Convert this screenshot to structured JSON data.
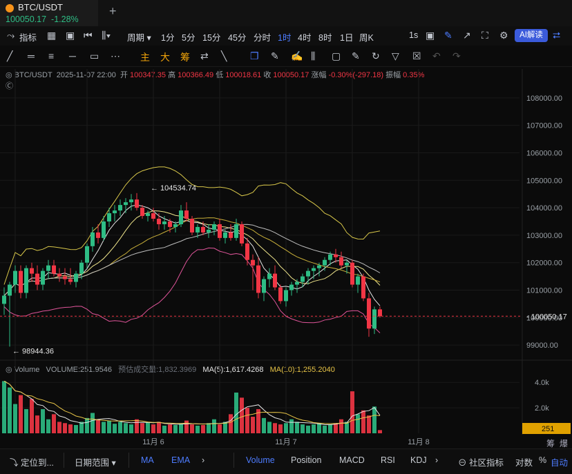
{
  "tab": {
    "symbol": "BTC/USDT",
    "price": "100050.17",
    "change": "-1.28%"
  },
  "toolbar1": {
    "indicators": "指标",
    "period": "周期",
    "intervals": [
      "1分",
      "5分",
      "15分",
      "45分",
      "分时",
      "1时",
      "4时",
      "8时",
      "1日",
      "周K"
    ],
    "active_interval": "1时",
    "seconds": "1s",
    "ai": "AI解读"
  },
  "toolbar2": {
    "labels": [
      "主",
      "大",
      "筹"
    ]
  },
  "info": {
    "symbol": "BTC/USDT",
    "time": "2025-11-07 22:00",
    "open_label": "开",
    "open": "100347.35",
    "high_label": "高",
    "high": "100366.49",
    "low_label": "低",
    "low": "100018.61",
    "close_label": "收",
    "close": "100050.17",
    "change_label": "涨幅",
    "change": "-0.30%(-297.18)",
    "amp_label": "振幅",
    "amp": "0.35%"
  },
  "volume_info": {
    "title": "Volume",
    "volume": "VOLUME:251.9546",
    "estimate_label": "预估成交量:",
    "estimate": "1,832.3969",
    "ma5": "MA(5):1,617.4268",
    "ma10": "MA(10):1,255.2040"
  },
  "bottom": {
    "locate": "定位到...",
    "range": "日期范围",
    "tabs": [
      "MA",
      "EMA",
      "Volume",
      "Position",
      "MACD",
      "RSI",
      "KDJ"
    ],
    "community": "社区指标",
    "log": "对数",
    "pct": "%",
    "auto": "自动",
    "chip": "筹",
    "burst": "爆"
  },
  "colors": {
    "up": "#2ebd85",
    "down": "#f23645",
    "accent": "#4d7cff",
    "yellow": "#e8c547",
    "pink": "#e0559a"
  },
  "chart_data": {
    "type": "candlestick",
    "title": "BTC/USDT 1时",
    "y_ticks": [
      108000,
      107000,
      106000,
      105000,
      104000,
      103000,
      102000,
      101000,
      100000,
      99000
    ],
    "y_tick_labels": [
      "108000.00",
      "107000.00",
      "106000.00",
      "105000.00",
      "104000.00",
      "103000.00",
      "102000.00",
      "101000.00",
      "100000.00",
      "99000.00"
    ],
    "ylim": [
      98500,
      108600
    ],
    "x_tick_labels": [
      {
        "label": "11月 6",
        "index": 27
      },
      {
        "label": "11月 7",
        "index": 51
      },
      {
        "label": "11月 8",
        "index": 75
      }
    ],
    "last_price": 100050.17,
    "last_price_label": "100050.17",
    "annotations": [
      {
        "label": "104534.74",
        "index": 26,
        "value": 104534.74,
        "kind": "high"
      },
      {
        "label": "98944.36",
        "index": 1,
        "value": 98944.36,
        "kind": "low"
      }
    ],
    "candles": [
      [
        100500,
        101100,
        100100,
        100800
      ],
      [
        100800,
        101300,
        98944,
        101200
      ],
      [
        101200,
        101900,
        100900,
        101700
      ],
      [
        101700,
        101900,
        100700,
        100900
      ],
      [
        100900,
        101900,
        100700,
        101800
      ],
      [
        101800,
        102000,
        101300,
        101600
      ],
      [
        101600,
        101900,
        101000,
        101200
      ],
      [
        101200,
        101800,
        101000,
        101700
      ],
      [
        101700,
        102100,
        101400,
        101900
      ],
      [
        101900,
        102100,
        101500,
        101600
      ],
      [
        101600,
        101800,
        101300,
        101500
      ],
      [
        101500,
        101800,
        101200,
        101400
      ],
      [
        101400,
        101800,
        101200,
        101300
      ],
      [
        101300,
        101700,
        101100,
        101600
      ],
      [
        101600,
        102100,
        101400,
        102000
      ],
      [
        102000,
        102700,
        101800,
        102600
      ],
      [
        102600,
        103300,
        102400,
        103100
      ],
      [
        103100,
        103400,
        102700,
        102900
      ],
      [
        102900,
        103700,
        102800,
        103500
      ],
      [
        103500,
        104000,
        103300,
        103800
      ],
      [
        103800,
        104100,
        103500,
        103900
      ],
      [
        103900,
        104300,
        103700,
        104100
      ],
      [
        104100,
        104350,
        103800,
        104200
      ],
      [
        104200,
        104500,
        103900,
        104300
      ],
      [
        104300,
        104534,
        103900,
        104000
      ],
      [
        104000,
        104100,
        103600,
        103700
      ],
      [
        103700,
        103900,
        103500,
        103800
      ],
      [
        103800,
        104000,
        103500,
        103600
      ],
      [
        103600,
        103800,
        103200,
        103400
      ],
      [
        103400,
        103700,
        103200,
        103500
      ],
      [
        103500,
        103600,
        103100,
        103300
      ],
      [
        103300,
        103500,
        103100,
        103400
      ],
      [
        103400,
        104100,
        103300,
        103900
      ],
      [
        103900,
        104200,
        103500,
        103600
      ],
      [
        103600,
        103700,
        103000,
        103100
      ],
      [
        103100,
        103400,
        102900,
        103300
      ],
      [
        103300,
        103500,
        103000,
        103100
      ],
      [
        103100,
        103400,
        102900,
        103200
      ],
      [
        103200,
        103500,
        103000,
        103400
      ],
      [
        103400,
        103600,
        102800,
        102900
      ],
      [
        102900,
        103200,
        102700,
        103100
      ],
      [
        103100,
        103400,
        102800,
        102900
      ],
      [
        102900,
        103600,
        102800,
        103400
      ],
      [
        103400,
        103500,
        102600,
        102700
      ],
      [
        102700,
        102900,
        101900,
        102100
      ],
      [
        102100,
        102300,
        101000,
        101900
      ],
      [
        101900,
        102200,
        100700,
        100900
      ],
      [
        100900,
        101500,
        100600,
        101400
      ],
      [
        101400,
        101800,
        101100,
        101600
      ],
      [
        101600,
        101900,
        101000,
        101100
      ],
      [
        101100,
        101200,
        100500,
        100600
      ],
      [
        100600,
        101100,
        100400,
        101000
      ],
      [
        101000,
        101300,
        100800,
        101200
      ],
      [
        101200,
        101400,
        100900,
        101300
      ],
      [
        101300,
        101600,
        101100,
        101500
      ],
      [
        101500,
        101800,
        101200,
        101700
      ],
      [
        101700,
        101900,
        101400,
        101800
      ],
      [
        101800,
        102000,
        101500,
        101900
      ],
      [
        101900,
        102200,
        101700,
        102100
      ],
      [
        102100,
        102400,
        101900,
        102300
      ],
      [
        102300,
        102500,
        102000,
        102200
      ],
      [
        102200,
        102400,
        101800,
        101900
      ],
      [
        101900,
        102100,
        101600,
        102000
      ],
      [
        102000,
        102100,
        101100,
        101200
      ],
      [
        101200,
        101600,
        100900,
        101500
      ],
      [
        101500,
        101600,
        100600,
        100700
      ],
      [
        100700,
        100900,
        99300,
        99600
      ],
      [
        99600,
        100400,
        99400,
        100300
      ],
      [
        100300,
        100400,
        100000,
        100050
      ]
    ],
    "volume": {
      "y_ticks": [
        4000,
        2000
      ],
      "y_tick_labels": [
        "4.0k",
        "2.0k"
      ],
      "ylim": [
        0,
        4500
      ],
      "current_label": "251",
      "values": [
        4100,
        3600,
        2300,
        3000,
        1900,
        2700,
        1400,
        1900,
        1100,
        1500,
        900,
        800,
        700,
        650,
        900,
        1200,
        1600,
        1100,
        900,
        1000,
        750,
        900,
        800,
        700,
        1100,
        800,
        850,
        700,
        900,
        600,
        700,
        650,
        750,
        1000,
        700,
        600,
        650,
        800,
        1100,
        700,
        900,
        1500,
        3200,
        2800,
        2000,
        1300,
        1900,
        1200,
        900,
        800,
        700,
        800,
        1100,
        900,
        700,
        600,
        700,
        800,
        600,
        700,
        800,
        1100,
        900,
        3300,
        1500,
        1800,
        1400,
        2100,
        252
      ]
    }
  }
}
